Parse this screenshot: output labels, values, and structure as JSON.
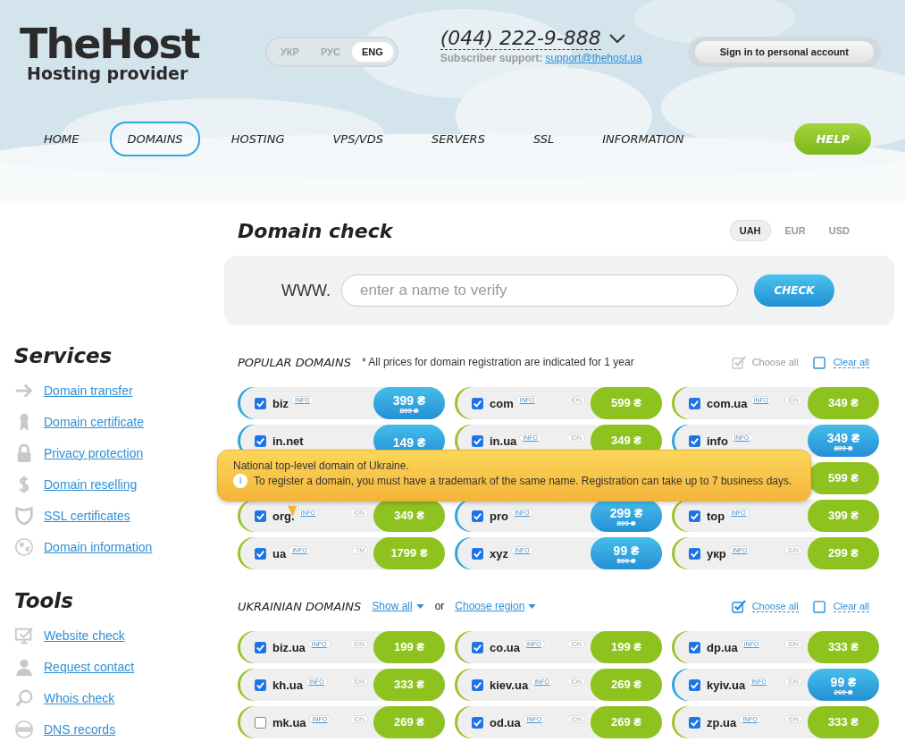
{
  "logo": {
    "name": "TheHost",
    "tagline": "Hosting provider"
  },
  "languages": [
    {
      "label": "УКР",
      "selected": false
    },
    {
      "label": "РУС",
      "selected": false
    },
    {
      "label": "ENG",
      "selected": true
    }
  ],
  "contact": {
    "phone": "(044) 222-9-888",
    "support_label": "Subscriber support:",
    "support_email": "support@thehost.ua"
  },
  "sign_in": "Sign in to personal account",
  "nav": [
    {
      "label": "HOME",
      "selected": false
    },
    {
      "label": "DOMAINS",
      "selected": true
    },
    {
      "label": "HOSTING",
      "selected": false
    },
    {
      "label": "VPS/VDS",
      "selected": false
    },
    {
      "label": "SERVERS",
      "selected": false
    },
    {
      "label": "SSL",
      "selected": false
    },
    {
      "label": "INFORMATION",
      "selected": false
    }
  ],
  "help": "HELP",
  "sidebar": [
    {
      "title": "Services",
      "links": [
        {
          "label": "Domain transfer",
          "kind": "arrow"
        },
        {
          "label": "Domain certificate",
          "kind": "ribbon"
        },
        {
          "label": "Privacy protection",
          "kind": "lock"
        },
        {
          "label": "Domain reselling",
          "kind": "dollar"
        },
        {
          "label": "SSL certificates",
          "kind": "shield"
        },
        {
          "label": "Domain information",
          "kind": "globe"
        }
      ]
    },
    {
      "title": "Tools",
      "links": [
        {
          "label": "Website check",
          "kind": "monitor"
        },
        {
          "label": "Request contact",
          "kind": "person"
        },
        {
          "label": "Whois check",
          "kind": "magnifier"
        },
        {
          "label": "DNS records",
          "kind": "dns"
        }
      ]
    }
  ],
  "domain_check": {
    "title": "Domain check",
    "currencies": [
      {
        "label": "UAH",
        "selected": true
      },
      {
        "label": "EUR",
        "selected": false
      },
      {
        "label": "USD",
        "selected": false
      }
    ],
    "prefix": "WWW.",
    "placeholder": "enter a name to verify",
    "button": "CHECK"
  },
  "popular": {
    "title": "POPULAR DOMAINS",
    "note": "* All prices for domain registration are indicated for 1 year",
    "choose_all": {
      "label": "Choose all",
      "checked": true,
      "disabled": true
    },
    "clear_all": {
      "label": "Clear all",
      "checked": false
    },
    "domains": [
      {
        "kind": "sale",
        "name": "biz",
        "checked": true,
        "info": "INFO",
        "price": "399 ₴",
        "old_price": "899 ₴"
      },
      {
        "kind": "regular",
        "name": "com",
        "checked": true,
        "info": "INFO",
        "tag": "IDN",
        "price": "599 ₴"
      },
      {
        "kind": "regular",
        "name": "com.ua",
        "checked": true,
        "info": "INFO",
        "tag": "IDN",
        "price": "349 ₴"
      },
      {
        "kind": "sale",
        "name": "in.net",
        "checked": true,
        "price": "149 ₴"
      },
      {
        "kind": "regular",
        "name": "in.ua",
        "checked": true,
        "info": "INFO",
        "tag": "IDN",
        "price": "349 ₴"
      },
      {
        "kind": "sale",
        "name": "info",
        "checked": true,
        "info": "INFO",
        "price": "349 ₴",
        "old_price": "899 ₴"
      },
      {
        "kind": "covered"
      },
      {
        "kind": "covered"
      },
      {
        "kind": "price_only",
        "price": "599 ₴"
      },
      {
        "kind": "regular",
        "name": "org.",
        "checked": true,
        "info": "INFO",
        "tag": "IDN",
        "price": "349 ₴"
      },
      {
        "kind": "sale",
        "name": "pro",
        "checked": true,
        "info": "INFO",
        "price": "299 ₴",
        "old_price": "899 ₴"
      },
      {
        "kind": "regular",
        "name": "top",
        "checked": true,
        "info": "INFO",
        "price": "399 ₴"
      },
      {
        "kind": "regular",
        "name": "ua",
        "checked": true,
        "info": "INFO",
        "tag": "TM",
        "price": "1799 ₴"
      },
      {
        "kind": "sale",
        "name": "xyz",
        "checked": true,
        "info": "INFO",
        "price": "99 ₴",
        "old_price": "599 ₴"
      },
      {
        "kind": "regular",
        "name": "укр",
        "checked": true,
        "info": "INFO",
        "tag": "IDN",
        "price": "299 ₴"
      }
    ],
    "tooltip": {
      "title": "National top-level domain of Ukraine.",
      "icon": "i",
      "text": "To register a domain, you must have a trademark of the same name. Registration can take up to 7 business days."
    }
  },
  "ukrainian": {
    "title": "UKRAINIAN DOMAINS",
    "show_all": "Show all",
    "or": "or",
    "choose_region": "Choose region",
    "choose_all": {
      "label": "Choose all",
      "checked": true,
      "disabled": false
    },
    "clear_all": {
      "label": "Clear all",
      "checked": false
    },
    "domains": [
      {
        "kind": "regular",
        "name": "biz.ua",
        "checked": true,
        "info": "INFO",
        "tag": "IDN",
        "price": "199 ₴"
      },
      {
        "kind": "regular",
        "name": "co.ua",
        "checked": true,
        "info": "INFO",
        "tag": "IDN",
        "price": "199 ₴"
      },
      {
        "kind": "regular",
        "name": "dp.ua",
        "checked": true,
        "info": "INFO",
        "tag": "IDN",
        "price": "333 ₴"
      },
      {
        "kind": "regular",
        "name": "kh.ua",
        "checked": true,
        "info": "INFO",
        "tag": "IDN",
        "price": "333 ₴"
      },
      {
        "kind": "regular",
        "name": "kiev.ua",
        "checked": true,
        "info": "INFO",
        "tag": "IDN",
        "price": "269 ₴"
      },
      {
        "kind": "sale",
        "name": "kyiv.ua",
        "checked": true,
        "info": "INFO",
        "tag": "IDN",
        "price": "99 ₴",
        "old_price": "269 ₴"
      },
      {
        "kind": "regular",
        "name": "mk.ua",
        "checked": false,
        "info": "INFO",
        "tag": "IDN",
        "price": "269 ₴"
      },
      {
        "kind": "regular",
        "name": "od.ua",
        "checked": true,
        "info": "INFO",
        "tag": "IDN",
        "price": "269 ₴"
      },
      {
        "kind": "regular",
        "name": "zp.ua",
        "checked": true,
        "info": "INFO",
        "tag": "IDN",
        "price": "333 ₴"
      }
    ]
  }
}
